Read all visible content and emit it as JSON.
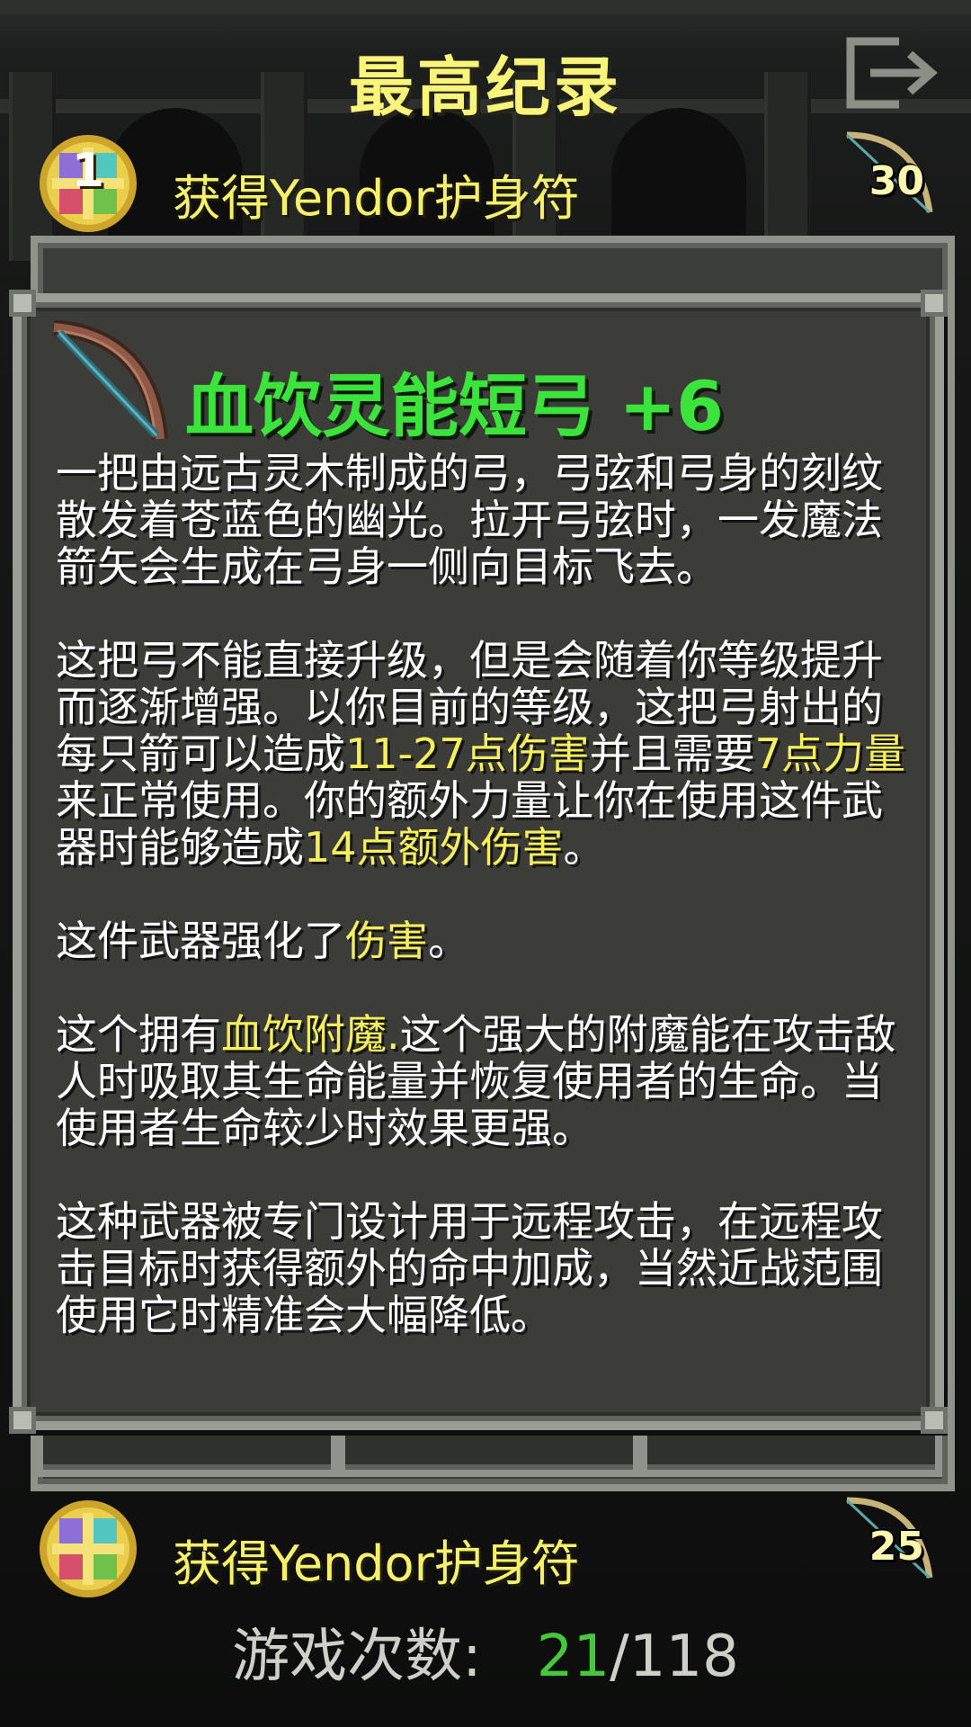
{
  "header": {
    "title": "最高纪录",
    "exit_icon": "exit-icon"
  },
  "records": [
    {
      "rank": "1",
      "text": "获得Yendor护身符",
      "depth": "30",
      "emblem_icon": "amulet-emblem-icon",
      "class_icon": "bow-icon"
    },
    {
      "rank": "",
      "text": "获得Yendor护身符",
      "depth": "25",
      "emblem_icon": "amulet-emblem-icon",
      "class_icon": "bow-icon"
    }
  ],
  "item": {
    "icon": "spirit-bow-icon",
    "name": "血饮灵能短弓 +6",
    "paragraphs": [
      {
        "parts": [
          "一把由远古灵木制成的弓，弓弦和弓身的刻纹散发着苍蓝色的幽光。拉开弓弦时，一发魔法箭矢会生成在弓身一侧向目标飞去。"
        ]
      },
      {
        "parts": [
          "这把弓不能直接升级，但是会随着你等级提升而逐渐增强。以你目前的等级，这把弓射出的每只箭可以造成",
          "11-27点伤害",
          "并且需要",
          "7点力量",
          "来正常使用。你的额外力量让你在使用这件武器时能够造成",
          "14点额外伤害",
          "。"
        ]
      },
      {
        "parts": [
          "这件武器强化了",
          "伤害",
          "。"
        ]
      },
      {
        "parts": [
          "这个拥有",
          "血饮附魔.",
          "这个强大的附魔能在攻击敌人时吸取其生命能量并恢复使用者的生命。当使用者生命较少时效果更强。"
        ]
      },
      {
        "parts": [
          "这种武器被专门设计用于远程攻击，在远程攻击目标时获得额外的命中加成，当然近战范围使用它时精准会大幅降低。"
        ]
      }
    ]
  },
  "footer": {
    "games_label": "游戏次数:",
    "games_won": "21",
    "games_sep": "/",
    "games_total": "118"
  },
  "colors": {
    "title": "#fbf47a",
    "item_name": "#3be43a",
    "highlight": "#f6ef5c",
    "won": "#45c83e"
  }
}
